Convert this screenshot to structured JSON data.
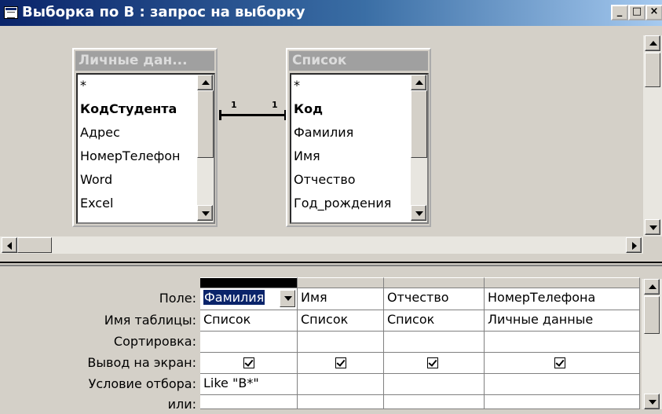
{
  "window": {
    "title": "Выборка по В : запрос на выборку",
    "minimize_label": "_",
    "restore_label": "□",
    "close_label": "×"
  },
  "tables": [
    {
      "title": "Личные дан...",
      "fields": [
        "*",
        "КодСтудента",
        "Адрес",
        "НомерТелефон",
        "Word",
        "Excel"
      ],
      "bold_field": "КодСтудента"
    },
    {
      "title": "Список",
      "fields": [
        "*",
        "Код",
        "Фамилия",
        "Имя",
        "Отчество",
        "Год_рождения"
      ],
      "bold_field": "Код"
    }
  ],
  "relationship": {
    "left_label": "1",
    "right_label": "1"
  },
  "grid": {
    "row_labels": {
      "field": "Поле:",
      "table": "Имя таблицы:",
      "sort": "Сортировка:",
      "show": "Вывод на экран:",
      "criteria": "Условие отбора:",
      "or": "или:"
    },
    "columns": [
      {
        "field": "Фамилия",
        "table": "Список",
        "sort": "",
        "show": true,
        "criteria": "Like \"В*\""
      },
      {
        "field": "Имя",
        "table": "Список",
        "sort": "",
        "show": true,
        "criteria": ""
      },
      {
        "field": "Отчество",
        "table": "Список",
        "sort": "",
        "show": true,
        "criteria": ""
      },
      {
        "field": "НомерТелефона",
        "table": "Личные данные",
        "sort": "",
        "show": true,
        "criteria": ""
      }
    ]
  }
}
